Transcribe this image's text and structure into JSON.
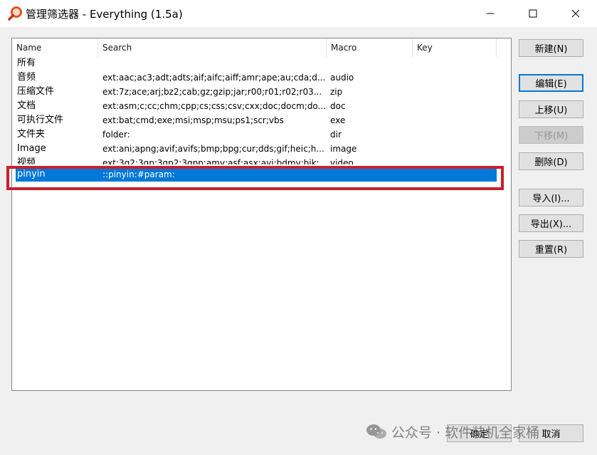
{
  "window": {
    "title": "管理筛选器 - Everything (1.5a)",
    "icon": "search-magnifier-icon",
    "controls": {
      "minimize": "minimize-icon",
      "maximize": "maximize-icon",
      "close": "close-icon"
    }
  },
  "columns": {
    "name": "Name",
    "search": "Search",
    "macro": "Macro",
    "key": "Key"
  },
  "rows": [
    {
      "name": "所有",
      "search": "",
      "macro": "",
      "key": ""
    },
    {
      "name": "音频",
      "search": "ext:aac;ac3;adt;adts;aif;aifc;aiff;amr;ape;au;cda;d...",
      "macro": "audio",
      "key": ""
    },
    {
      "name": "压缩文件",
      "search": "ext:7z;ace;arj;bz2;cab;gz;gzip;jar;r00;r01;r02;r03...",
      "macro": "zip",
      "key": ""
    },
    {
      "name": "文档",
      "search": "ext:asm;c;cc;chm;cpp;cs;css;csv;cxx;doc;docm;do...",
      "macro": "doc",
      "key": ""
    },
    {
      "name": "可执行文件",
      "search": "ext:bat;cmd;exe;msi;msp;msu;ps1;scr;vbs",
      "macro": "exe",
      "key": ""
    },
    {
      "name": "文件夹",
      "search": "folder:",
      "macro": "dir",
      "key": ""
    },
    {
      "name": "Image",
      "search": "ext:ani;apng;avif;avifs;bmp;bpg;cur;dds;gif;heic;h...",
      "macro": "image",
      "key": ""
    },
    {
      "name": "视频",
      "search": "ext:3g2;3gp;3gp2;3gpp;amv;asf;asx;avi;bdmv;bik;...",
      "macro": "video",
      "key": ""
    },
    {
      "name": "pinyin",
      "search": "::pinyin:#param:",
      "macro": "",
      "key": ""
    }
  ],
  "buttons": {
    "new": "新建(N)",
    "edit": "编辑(E)",
    "move_up": "上移(U)",
    "move_down": "下移(M)",
    "delete": "删除(D)",
    "import": "导入(I)...",
    "export": "导出(X)...",
    "reset": "重置(R)",
    "ok": "确定",
    "cancel": "取消"
  },
  "watermark": {
    "text": "公众号 · 软件装机全家桶",
    "icon": "wechat-icon"
  },
  "colors": {
    "selection": "#0078d7",
    "highlight_box": "#c8202d",
    "default_button_border": "#0078d7"
  }
}
